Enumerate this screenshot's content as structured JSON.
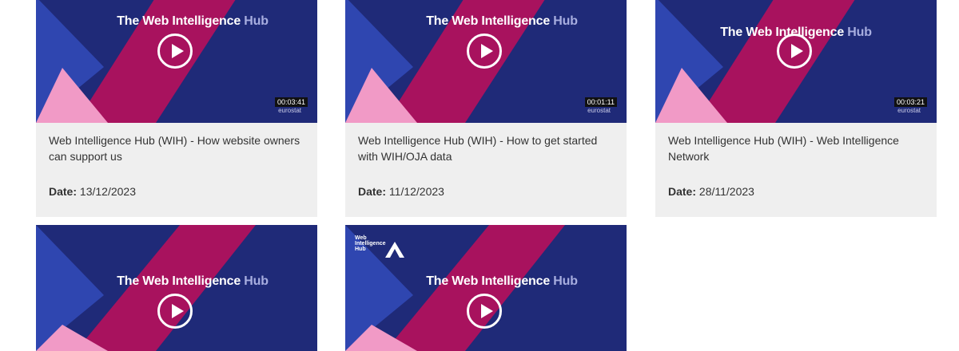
{
  "thumbnail": {
    "title_main": "The Web Intelligence",
    "title_accent": "Hub",
    "brand": "eurostat",
    "logo_text": "Web Intelligence Hub"
  },
  "labels": {
    "date": "Date:"
  },
  "videos": [
    {
      "title": "Web Intelligence Hub (WIH) - How website owners can support us",
      "date": "13/12/2023",
      "duration": "00:03:41"
    },
    {
      "title": "Web Intelligence Hub (WIH) - How to get started with WIH/OJA data",
      "date": "11/12/2023",
      "duration": "00:01:11"
    },
    {
      "title": "Web Intelligence Hub (WIH) - Web Intelligence Network",
      "date": "28/11/2023",
      "duration": "00:03:21"
    },
    {
      "title": "",
      "date": "",
      "duration": ""
    },
    {
      "title": "",
      "date": "",
      "duration": ""
    }
  ],
  "colors": {
    "navy": "#1f2a78",
    "magenta": "#a8125e",
    "pink": "#f19ac6",
    "blue": "#2f46b0"
  }
}
